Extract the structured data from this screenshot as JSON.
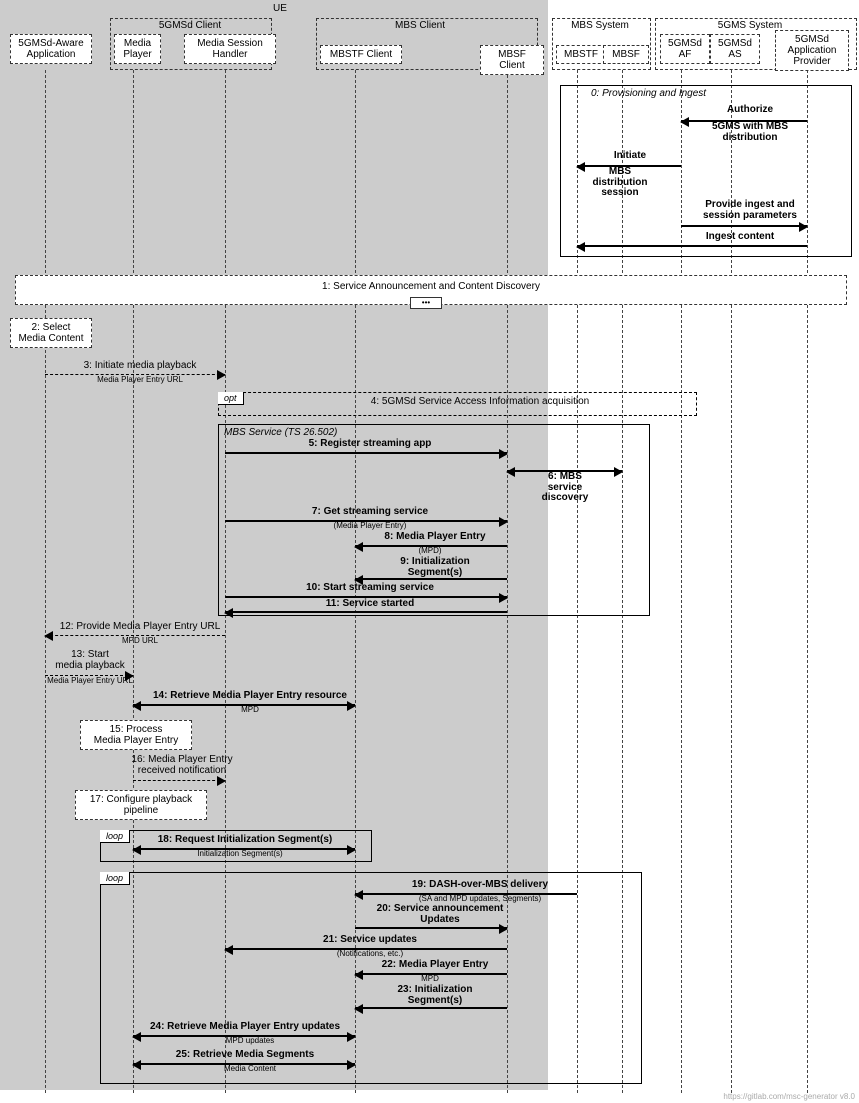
{
  "groups": {
    "ue": "UE",
    "gmsd_client": "5GMSd Client",
    "mbs_client": "MBS Client",
    "mbs_system": "MBS System",
    "gms_system": "5GMS System"
  },
  "participants": {
    "app": "5GMSd-Aware\nApplication",
    "mediaplayer": "Media\nPlayer",
    "msh": "Media Session\nHandler",
    "mbstf_client": "MBSTF Client",
    "mbsf_client": "MBSF Client",
    "mbstf": "MBSTF",
    "mbsf": "MBSF",
    "gmsd_af": "5GMSd\nAF",
    "gmsd_as": "5GMSd\nAS",
    "app_provider": "5GMSd\nApplication\nProvider"
  },
  "blocks": {
    "provisioning_title": "0: Provisioning and Ingest",
    "mbs_service_title": "MBS Service (TS 26.502)"
  },
  "messages": {
    "authorize": "Authorize",
    "authorize_sub": "5GMS with MBS\ndistribution",
    "initiate_mbs": "Initiate",
    "initiate_mbs_sub": "MBS\ndistribution\nsession",
    "provide_ingest": "Provide ingest and\nsession parameters",
    "ingest_content": "Ingest content",
    "announce": "1: Service Announcement and Content Discovery",
    "select": "2: Select\nMedia Content",
    "initiate_playback": "3: Initiate media playback",
    "initiate_playback_sub": "Media Player Entry URL",
    "sai_acq": "4: 5GMSd Service Access Information acquisition",
    "register": "5: Register streaming app",
    "discovery": "6: MBS\nservice\ndiscovery",
    "get_service": "7: Get streaming service",
    "get_service_sub": "(Media Player Entry)",
    "mpe": "8: Media Player Entry",
    "mpe_sub": "(MPD)",
    "init_seg": "9: Initialization\nSegment(s)",
    "start_stream": "10: Start streaming service",
    "started": "11: Service started",
    "provide_mpe_url": "12: Provide Media Player Entry URL",
    "provide_mpe_url_sub": "MPD URL",
    "start_playback": "13: Start\nmedia playback",
    "start_playback_sub": "Media Player Entry URL",
    "retrieve_mpe": "14: Retrieve Media Player Entry resource",
    "retrieve_mpe_sub": "MPD",
    "process_mpe": "15: Process\nMedia Player Entry",
    "received_notif": "16: Media Player Entry\nreceived notification",
    "configure_pipeline": "17: Configure playback\npipeline",
    "req_init": "18: Request Initialization Segment(s)",
    "req_init_sub": "Initialization Segment(s)",
    "dash_mbs": "19: DASH-over-MBS delivery",
    "dash_mbs_sub": "(SA and MPD updates, Segments)",
    "sa_updates": "20: Service announcement\nUpdates",
    "svc_updates": "21: Service updates",
    "svc_updates_sub": "(Notifications, etc.)",
    "mpe22": "22: Media Player Entry",
    "mpe22_sub": "MPD",
    "init23": "23: Initialization\nSegment(s)",
    "retrieve_updates": "24: Retrieve Media Player Entry updates",
    "retrieve_updates_sub": "MPD updates",
    "retrieve_segments": "25: Retrieve Media Segments",
    "retrieve_segments_sub": "Media Content"
  },
  "tags": {
    "opt": "opt",
    "loop": "loop"
  },
  "footer": "https://gitlab.com/msc-generator v8.0"
}
